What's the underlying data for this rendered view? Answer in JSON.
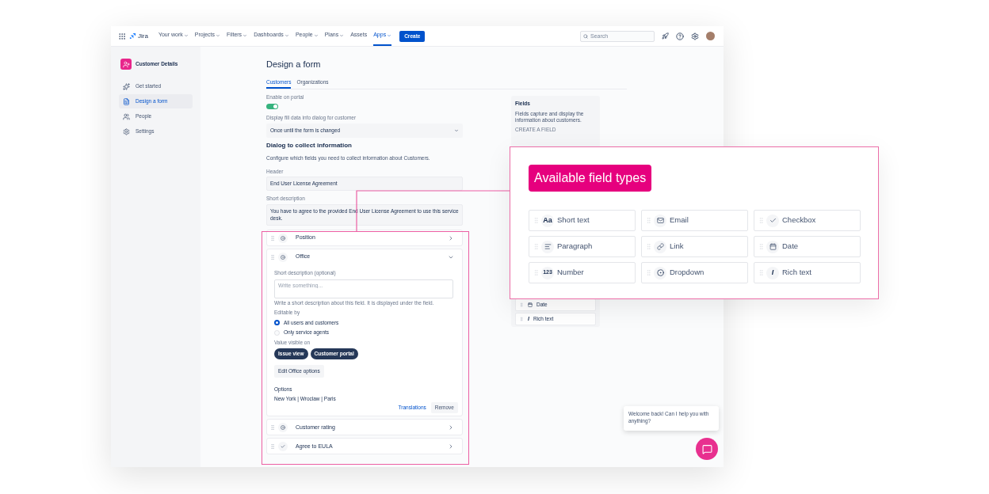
{
  "nav": {
    "logo": "Jira",
    "menus": [
      {
        "label": "Your work",
        "dropdown": true,
        "selected": false
      },
      {
        "label": "Projects",
        "dropdown": true,
        "selected": false
      },
      {
        "label": "Filters",
        "dropdown": true,
        "selected": false
      },
      {
        "label": "Dashboards",
        "dropdown": true,
        "selected": false
      },
      {
        "label": "People",
        "dropdown": true,
        "selected": false
      },
      {
        "label": "Plans",
        "dropdown": true,
        "selected": false
      },
      {
        "label": "Assets",
        "dropdown": false,
        "selected": false
      },
      {
        "label": "Apps",
        "dropdown": true,
        "selected": true
      }
    ],
    "create": "Create",
    "search": {
      "placeholder": "Search"
    }
  },
  "sidebar": {
    "project": "Customer Details",
    "items": [
      {
        "label": "Get started",
        "selected": false
      },
      {
        "label": "Design a form",
        "selected": true
      },
      {
        "label": "People",
        "selected": false
      },
      {
        "label": "Settings",
        "selected": false
      }
    ]
  },
  "page": {
    "title": "Design a form",
    "tabs": [
      {
        "label": "Customers",
        "selected": true
      },
      {
        "label": "Organizations",
        "selected": false
      }
    ],
    "enable_label": "Enable on portal",
    "enable_on": true,
    "display_label": "Display fill data info dialog for customer",
    "display_value": "Once until the form is changed",
    "section_title": "Dialog to collect information",
    "section_desc": "Configure which fields you need to collect information about Customers.",
    "header_label": "Header",
    "header_value": "End User License Agreement",
    "short_desc_label": "Short description",
    "short_desc_value": "You have to agree to the provided End User License Agreement to use this service desk."
  },
  "fields": [
    {
      "label": "Position",
      "kind": "dropdown",
      "expanded": false
    },
    {
      "label": "Office",
      "kind": "dropdown",
      "expanded": true
    },
    {
      "label": "Customer rating",
      "kind": "dropdown",
      "expanded": false
    },
    {
      "label": "Agree to EULA",
      "kind": "checkbox",
      "expanded": false
    }
  ],
  "office_details": {
    "desc_label": "Short description (optional)",
    "desc_placeholder": "Write something...",
    "desc_help": "Write a short description about this field. It is displayed under the field.",
    "editable_label": "Editable by",
    "editable_options": [
      {
        "label": "All users and customers",
        "selected": true
      },
      {
        "label": "Only service agents",
        "selected": false
      }
    ],
    "visible_label": "Value visible on",
    "visible_chips": [
      {
        "label": "Issue view",
        "selected": true
      },
      {
        "label": "Customer portal",
        "selected": true
      }
    ],
    "edit_button": "Edit Office options",
    "options_label": "Options",
    "options_value": "New York | Wroclaw | Paris",
    "translations": "Translations",
    "remove": "Remove"
  },
  "fields_panel": {
    "title": "Fields",
    "desc": "Fields capture and display the information about customers.",
    "create_label": "CREATE A FIELD",
    "items": [
      {
        "label": "Date",
        "kind": "date"
      },
      {
        "label": "Rich text",
        "kind": "rich",
        "glyph": "I"
      }
    ]
  },
  "callout": {
    "title": "Available field types",
    "types": [
      {
        "label": "Short text",
        "kind": "text",
        "glyph": "Aa"
      },
      {
        "label": "Email",
        "kind": "email"
      },
      {
        "label": "Checkbox",
        "kind": "checkbox"
      },
      {
        "label": "Paragraph",
        "kind": "paragraph"
      },
      {
        "label": "Link",
        "kind": "link"
      },
      {
        "label": "Date",
        "kind": "date"
      },
      {
        "label": "Number",
        "kind": "number",
        "glyph": "123"
      },
      {
        "label": "Dropdown",
        "kind": "dropdown"
      },
      {
        "label": "Rich text",
        "kind": "rich",
        "glyph": "I"
      }
    ]
  },
  "chat": {
    "message": "Welcome back! Can I help you with anything?"
  }
}
